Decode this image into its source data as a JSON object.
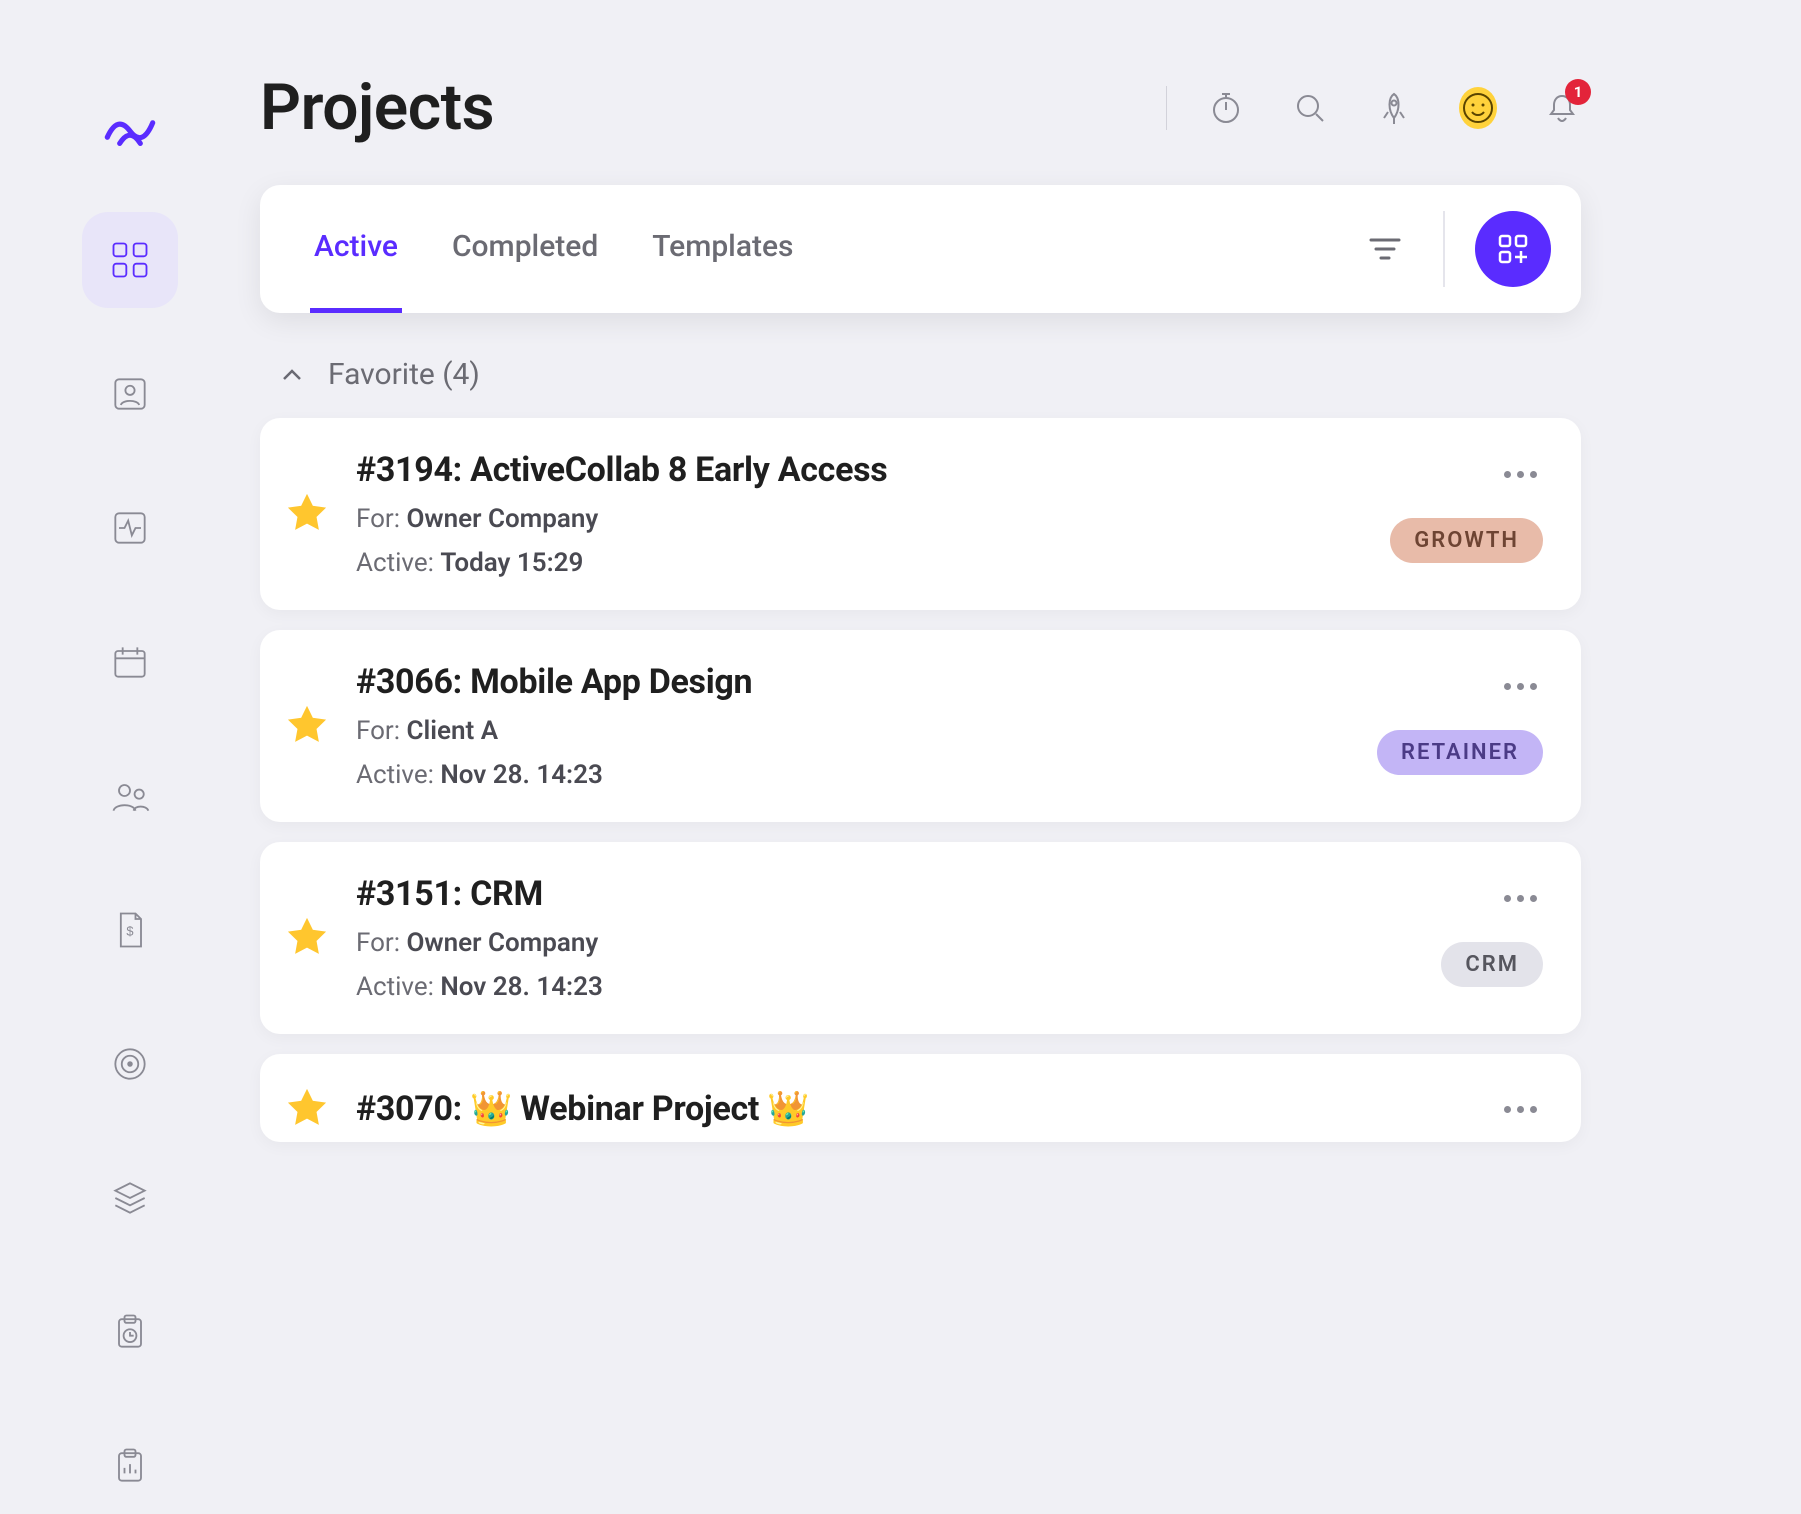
{
  "header": {
    "title": "Projects",
    "notification_count": "1"
  },
  "tabs": {
    "active": "Active",
    "completed": "Completed",
    "templates": "Templates"
  },
  "section": {
    "label": "Favorite (4)"
  },
  "meta_labels": {
    "for": "For:",
    "active": "Active:"
  },
  "projects": [
    {
      "title": "#3194: ActiveCollab 8 Early Access",
      "for": "Owner Company",
      "active": "Today 15:29",
      "badge": "GROWTH",
      "badge_class": "growth"
    },
    {
      "title": "#3066: Mobile App Design",
      "for": "Client A",
      "active": "Nov 28. 14:23",
      "badge": "RETAINER",
      "badge_class": "retainer"
    },
    {
      "title": "#3151: CRM",
      "for": "Owner Company",
      "active": "Nov 28. 14:23",
      "badge": "CRM",
      "badge_class": "crm"
    },
    {
      "title": "#3070: 👑 Webinar Project 👑",
      "for": "",
      "active": "",
      "badge": "",
      "badge_class": ""
    }
  ]
}
